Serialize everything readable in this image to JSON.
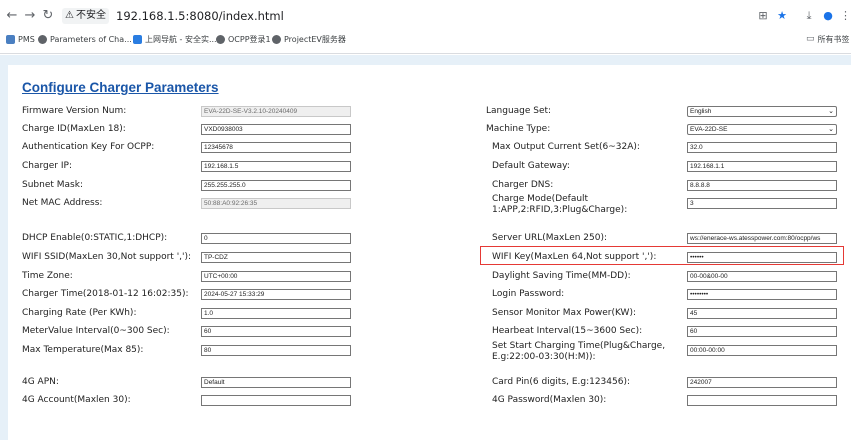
{
  "browser": {
    "security_label": "不安全",
    "url": "192.168.1.5:8080/index.html",
    "bookmarks": [
      "PMS",
      "Parameters of Cha...",
      "上网导航 - 安全实...",
      "OCPP登录1",
      "ProjectEV服务器"
    ],
    "all_bookmarks": "所有书签"
  },
  "page": {
    "title": "Configure Charger Parameters"
  },
  "left_fields": [
    {
      "label": "Firmware Version Num:",
      "value": "EVA-22D-SE-V3.2.10-20240409"
    },
    {
      "label": "Charge ID(MaxLen 18):",
      "value": "VXD0938003"
    },
    {
      "label": "Authentication Key For OCPP:",
      "value": "12345678"
    },
    {
      "label": "Charger IP:",
      "value": "192.168.1.5"
    },
    {
      "label": "Subnet Mask:",
      "value": "255.255.255.0"
    },
    {
      "label": "Net MAC Address:",
      "value": "50:88:A0:92:26:35"
    },
    {
      "label": "DHCP Enable(0:STATIC,1:DHCP):",
      "value": "0"
    },
    {
      "label": "WIFI SSID(MaxLen 30,Not support ','):",
      "value": "TP-CDZ"
    },
    {
      "label": "Time Zone:",
      "value": "UTC+00:00"
    },
    {
      "label": "Charger Time(2018-01-12 16:02:35):",
      "value": "2024-05-27 15:33:29"
    },
    {
      "label": "Charging Rate (Per KWh):",
      "value": "1.0"
    },
    {
      "label": "MeterValue Interval(0~300 Sec):",
      "value": "60"
    },
    {
      "label": "Max Temperature(Max 85):",
      "value": "80"
    },
    {
      "label": "4G APN:",
      "value": "Default"
    },
    {
      "label": "4G Account(Maxlen 30):",
      "value": ""
    }
  ],
  "right_fields": [
    {
      "label": "Language Set:",
      "value": "English"
    },
    {
      "label": "Machine Type:",
      "value": "EVA-22D-SE"
    },
    {
      "label": "Max Output Current Set(6~32A):",
      "value": "32.0"
    },
    {
      "label": "Default Gateway:",
      "value": "192.168.1.1"
    },
    {
      "label": "Charger DNS:",
      "value": "8.8.8.8"
    },
    {
      "label": "Charge Mode(Default",
      "label2": "1:APP,2:RFID,3:Plug&Charge):",
      "value": "3"
    },
    {
      "label": "Server URL(MaxLen 250):",
      "value": "ws://enerace-ws.atesspower.com:80/ocpp/ws"
    },
    {
      "label": "WIFI Key(MaxLen 64,Not support ','):",
      "value": "••••••"
    },
    {
      "label": "Daylight Saving Time(MM-DD):",
      "value": "00-00&00-00"
    },
    {
      "label": "Login Password:",
      "value": "••••••••"
    },
    {
      "label": "Sensor Monitor Max Power(KW):",
      "value": "45"
    },
    {
      "label": "Hearbeat Interval(15~3600 Sec):",
      "value": "60"
    },
    {
      "label": "Set Start Charging Time(Plug&Charge,",
      "label2": "E.g:22:00-03:30(H:M)):",
      "value": "00:00-00:00"
    },
    {
      "label": "Card Pin(6 digits, E.g:123456):",
      "value": "242007"
    },
    {
      "label": "4G Password(Maxlen 30):",
      "value": ""
    }
  ]
}
